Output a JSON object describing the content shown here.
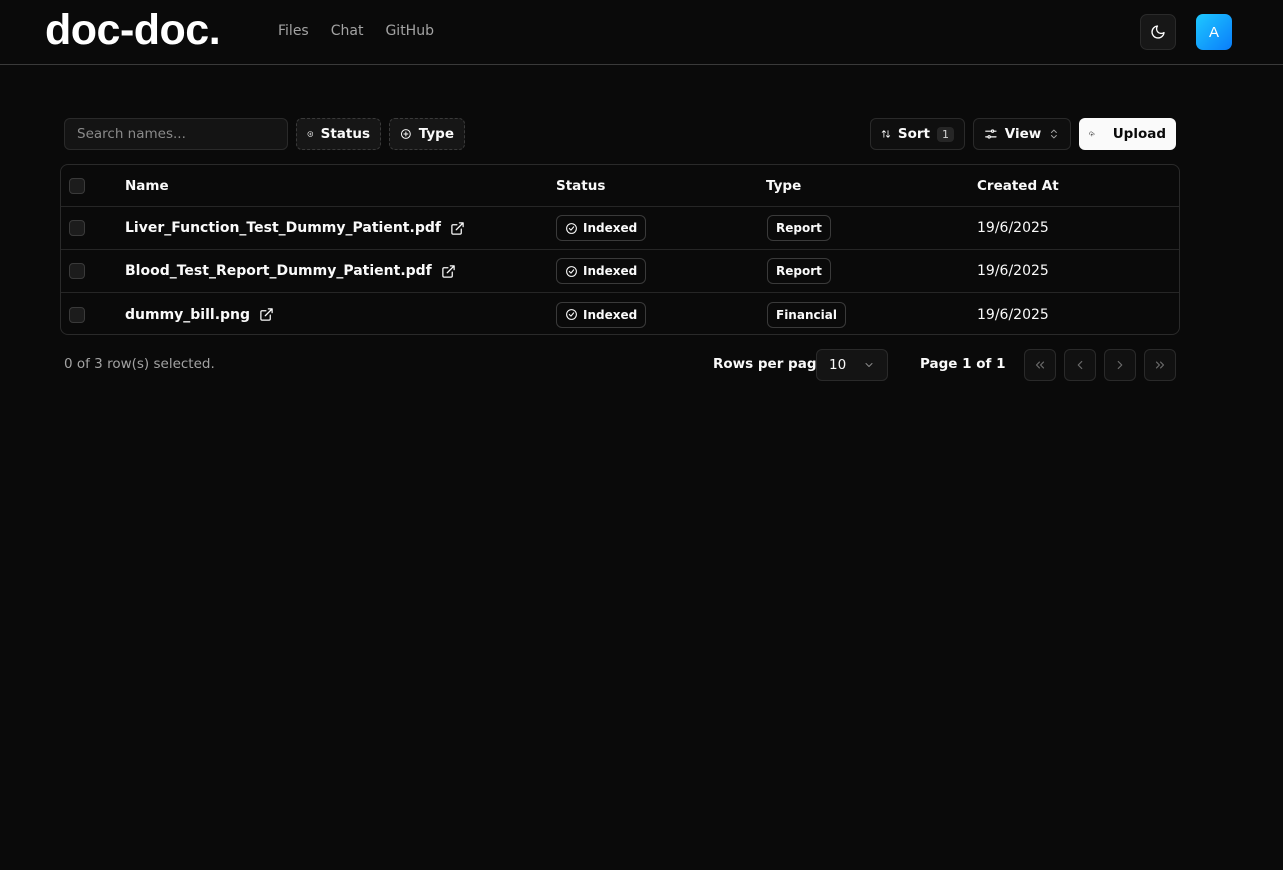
{
  "header": {
    "logo": "doc-doc.",
    "nav": [
      "Files",
      "Chat",
      "GitHub"
    ],
    "avatar_letter": "A"
  },
  "toolbar": {
    "search_placeholder": "Search names...",
    "status_filter": "Status",
    "type_filter": "Type",
    "sort_label": "Sort",
    "sort_count": "1",
    "view_label": "View",
    "upload_label": "Upload"
  },
  "table": {
    "columns": [
      "Name",
      "Status",
      "Type",
      "Created At"
    ],
    "rows": [
      {
        "name": "Liver_Function_Test_Dummy_Patient.pdf",
        "status": "Indexed",
        "type": "Report",
        "created": "19/6/2025"
      },
      {
        "name": "Blood_Test_Report_Dummy_Patient.pdf",
        "status": "Indexed",
        "type": "Report",
        "created": "19/6/2025"
      },
      {
        "name": "dummy_bill.png",
        "status": "Indexed",
        "type": "Financial",
        "created": "19/6/2025"
      }
    ]
  },
  "footer": {
    "selected_info": "0 of 3 row(s) selected.",
    "rows_per_page_label": "Rows per page",
    "rows_per_page_value": "10",
    "page_info": "Page 1 of 1"
  }
}
